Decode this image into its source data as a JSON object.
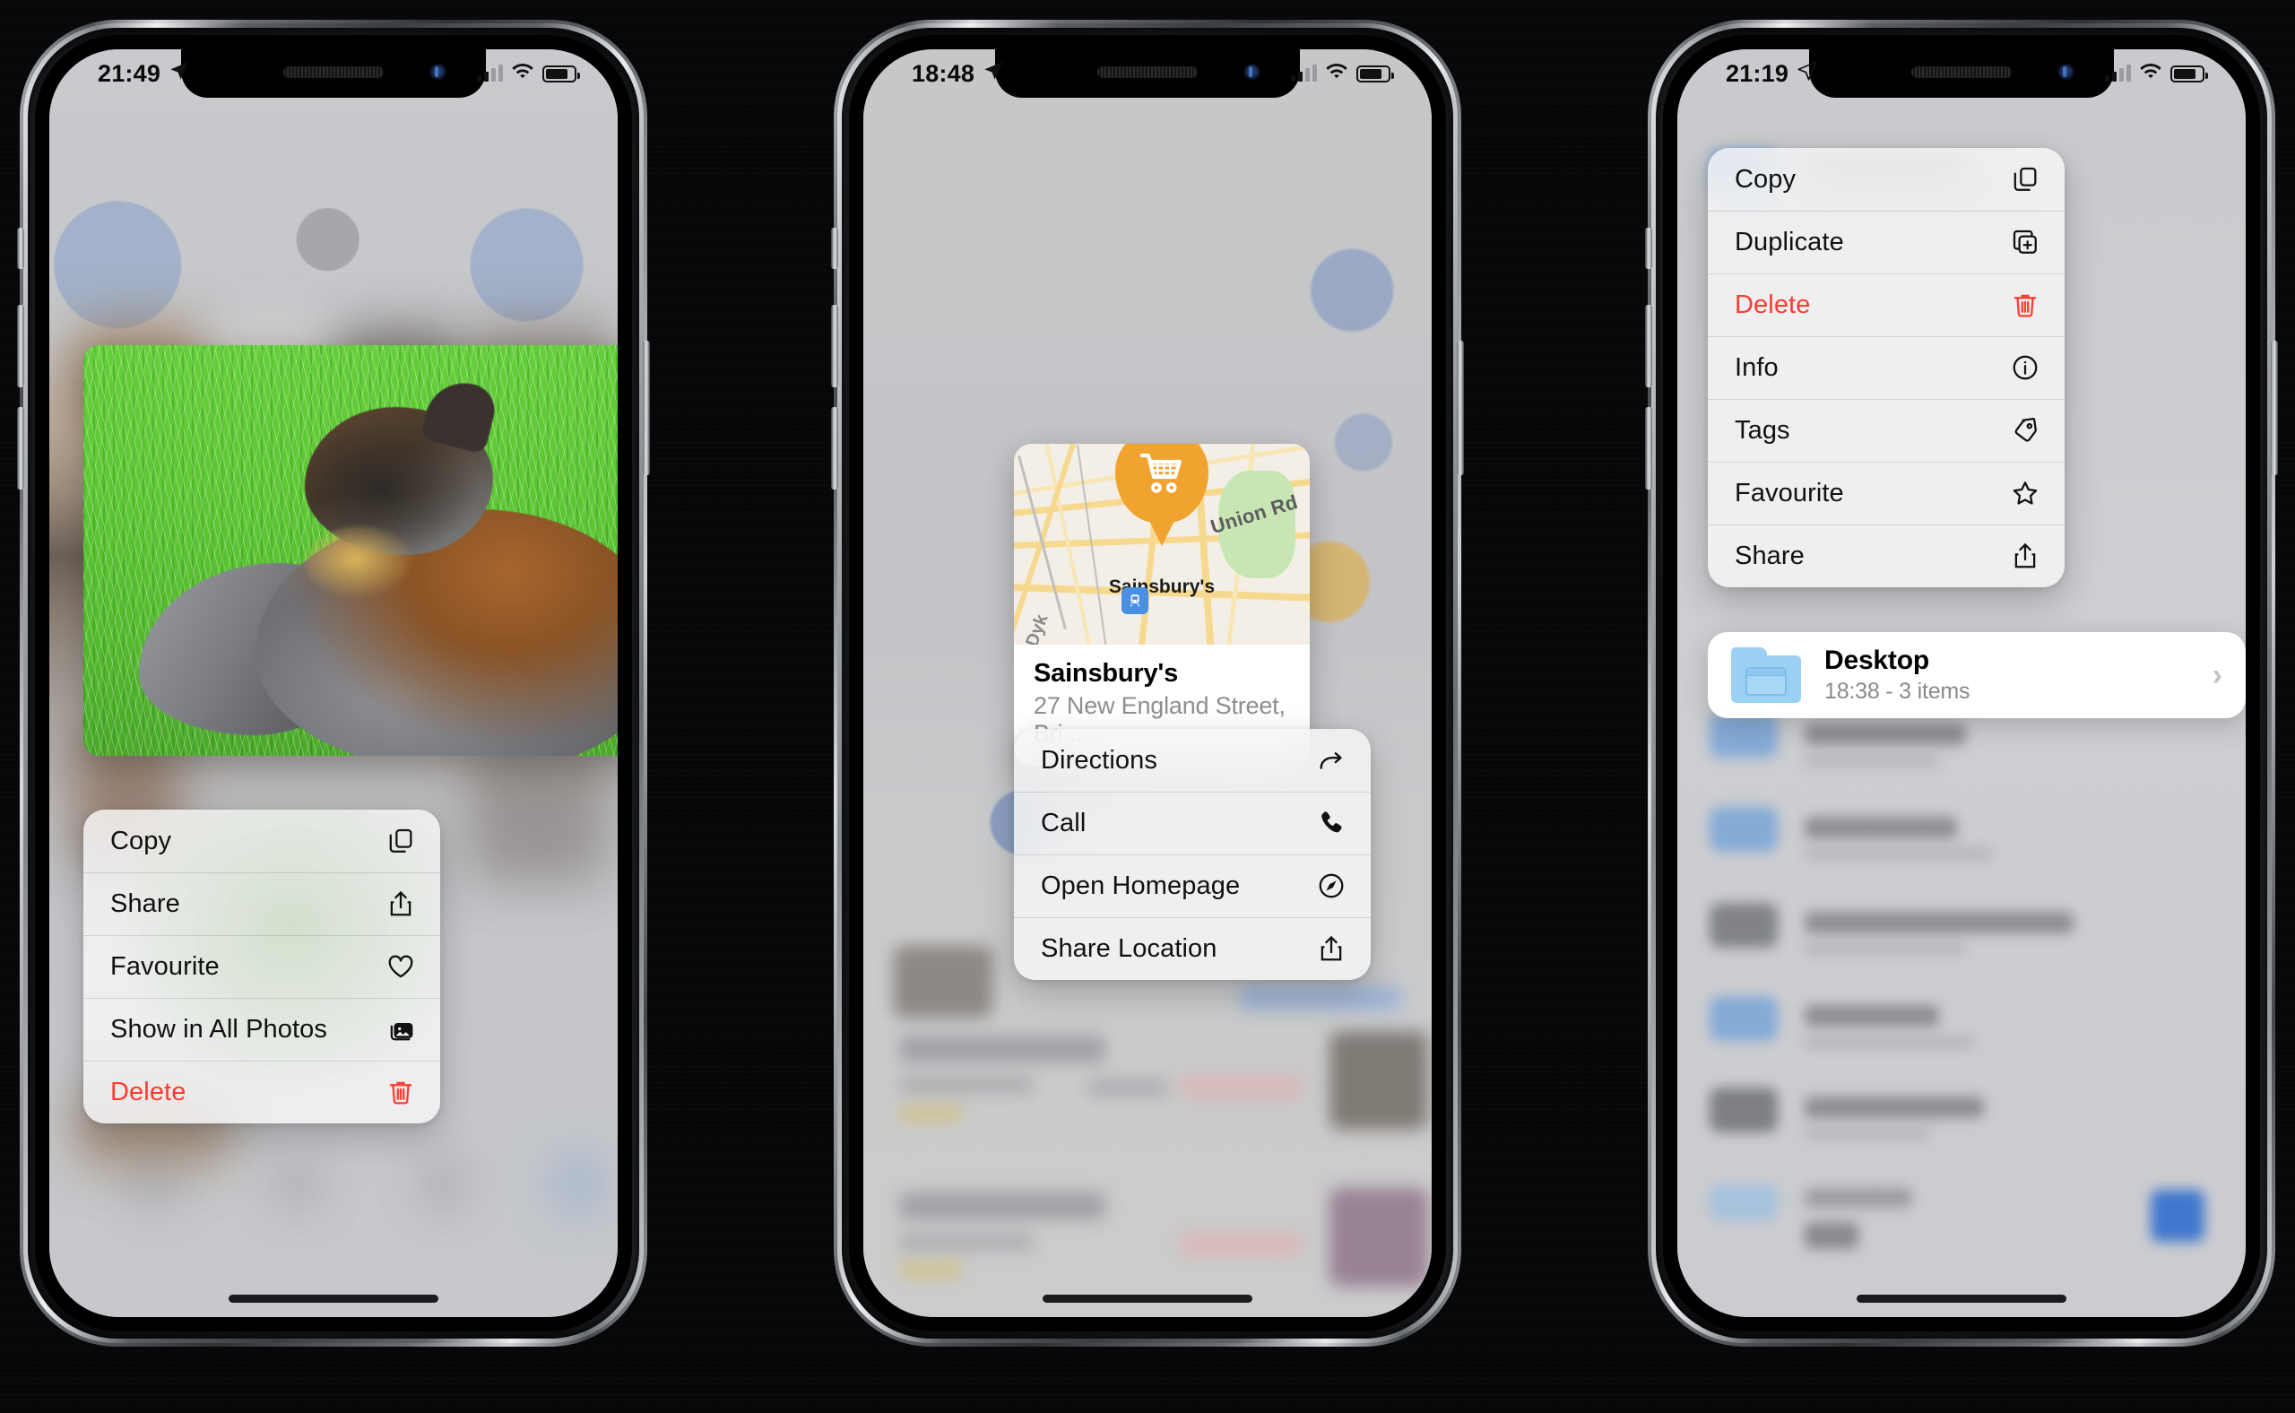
{
  "phones": [
    {
      "id": "phone-photos",
      "status": {
        "time": "21:49",
        "location_icon": "location-arrow-icon",
        "signal_icon": "cellular-bars-icon",
        "wifi_icon": "wifi-icon",
        "battery_icon": "battery-icon"
      },
      "app": "Photos",
      "preview": {
        "type": "photo",
        "description": "cat-in-grass-photo"
      },
      "menu": {
        "items": [
          {
            "label": "Copy",
            "icon": "copy-icon",
            "destructive": false
          },
          {
            "label": "Share",
            "icon": "share-icon",
            "destructive": false
          },
          {
            "label": "Favourite",
            "icon": "heart-icon",
            "destructive": false
          },
          {
            "label": "Show in All Photos",
            "icon": "photos-stack-icon",
            "destructive": false
          },
          {
            "label": "Delete",
            "icon": "trash-icon",
            "destructive": true
          }
        ]
      }
    },
    {
      "id": "phone-maps",
      "status": {
        "time": "18:48",
        "location_icon": "location-arrow-icon",
        "signal_icon": "cellular-bars-icon",
        "wifi_icon": "wifi-icon",
        "battery_icon": "battery-icon"
      },
      "app": "Maps",
      "place_card": {
        "pin_icon": "shopping-cart-icon",
        "map_pin_label": "Sainsbury's",
        "map_labels": {
          "road_union": "Union Rd",
          "road_dyke": "Dyk",
          "transit_icon": "train-icon"
        },
        "title": "Sainsbury's",
        "subtitle": "27 New England Street, Bri..."
      },
      "menu": {
        "items": [
          {
            "label": "Directions",
            "icon": "directions-arrow-icon",
            "destructive": false
          },
          {
            "label": "Call",
            "icon": "phone-icon",
            "destructive": false
          },
          {
            "label": "Open Homepage",
            "icon": "safari-compass-icon",
            "destructive": false
          },
          {
            "label": "Share Location",
            "icon": "share-icon",
            "destructive": false
          }
        ]
      }
    },
    {
      "id": "phone-files",
      "status": {
        "time": "21:19",
        "location_icon": "location-arrow-icon",
        "signal_icon": "cellular-bars-icon",
        "wifi_icon": "wifi-icon",
        "battery_icon": "battery-icon"
      },
      "app": "Files",
      "menu": {
        "items": [
          {
            "label": "Copy",
            "icon": "copy-icon",
            "destructive": false
          },
          {
            "label": "Duplicate",
            "icon": "duplicate-icon",
            "destructive": false
          },
          {
            "label": "Delete",
            "icon": "trash-icon",
            "destructive": true
          },
          {
            "label": "Info",
            "icon": "info-icon",
            "destructive": false
          },
          {
            "label": "Tags",
            "icon": "tag-icon",
            "destructive": false
          },
          {
            "label": "Favourite",
            "icon": "star-icon",
            "destructive": false
          },
          {
            "label": "Share",
            "icon": "share-icon",
            "destructive": false
          }
        ]
      },
      "file_row": {
        "icon": "folder-icon",
        "name": "Desktop",
        "meta": "18:38 - 3 items",
        "chevron": "chevron-right-icon"
      }
    }
  ],
  "colors": {
    "destructive_red": "#ff3b30",
    "menu_background": "#f7f7f7",
    "pin_orange": "#f0a32e",
    "folder_blue": "#9bd0f5",
    "accent_blue": "#4a90e2",
    "grass_green": "#5dc733"
  }
}
